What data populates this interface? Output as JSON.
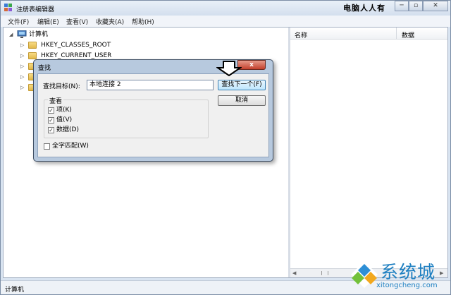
{
  "window": {
    "title": "注册表编辑器",
    "brand": "电脑人人有",
    "minimize_glyph": "─",
    "restore_glyph": "▫",
    "close_glyph": "✕"
  },
  "menu": [
    "文件(F)",
    "编辑(E)",
    "查看(V)",
    "收藏夹(A)",
    "帮助(H)"
  ],
  "tree": {
    "root": "计算机",
    "items": [
      "HKEY_CLASSES_ROOT",
      "HKEY_CURRENT_USER",
      "",
      "",
      ""
    ]
  },
  "list": {
    "col_name": "名称",
    "col_data": "数据"
  },
  "status": {
    "path": "计算机"
  },
  "dialog": {
    "title": "查找",
    "close_glyph": "x",
    "target_label": "查找目标(N):",
    "target_value": "本地连接 2",
    "find_next_label": "查找下一个(F)",
    "cancel_label": "取消",
    "look_at_label": "查看",
    "options": [
      {
        "label": "项(K)",
        "checked": true,
        "mark": "✓"
      },
      {
        "label": "值(V)",
        "checked": true,
        "mark": "✓"
      },
      {
        "label": "数据(D)",
        "checked": true,
        "mark": "✓"
      }
    ],
    "whole_string": {
      "label": "全字匹配(W)",
      "checked": false,
      "mark": ""
    }
  },
  "watermark": {
    "title": "系统城",
    "url": "xitongcheng.com"
  },
  "colors": {
    "accent": "#1d7fc1",
    "dialog_frame": "#b7c9de",
    "close_red": "#c3402c"
  }
}
